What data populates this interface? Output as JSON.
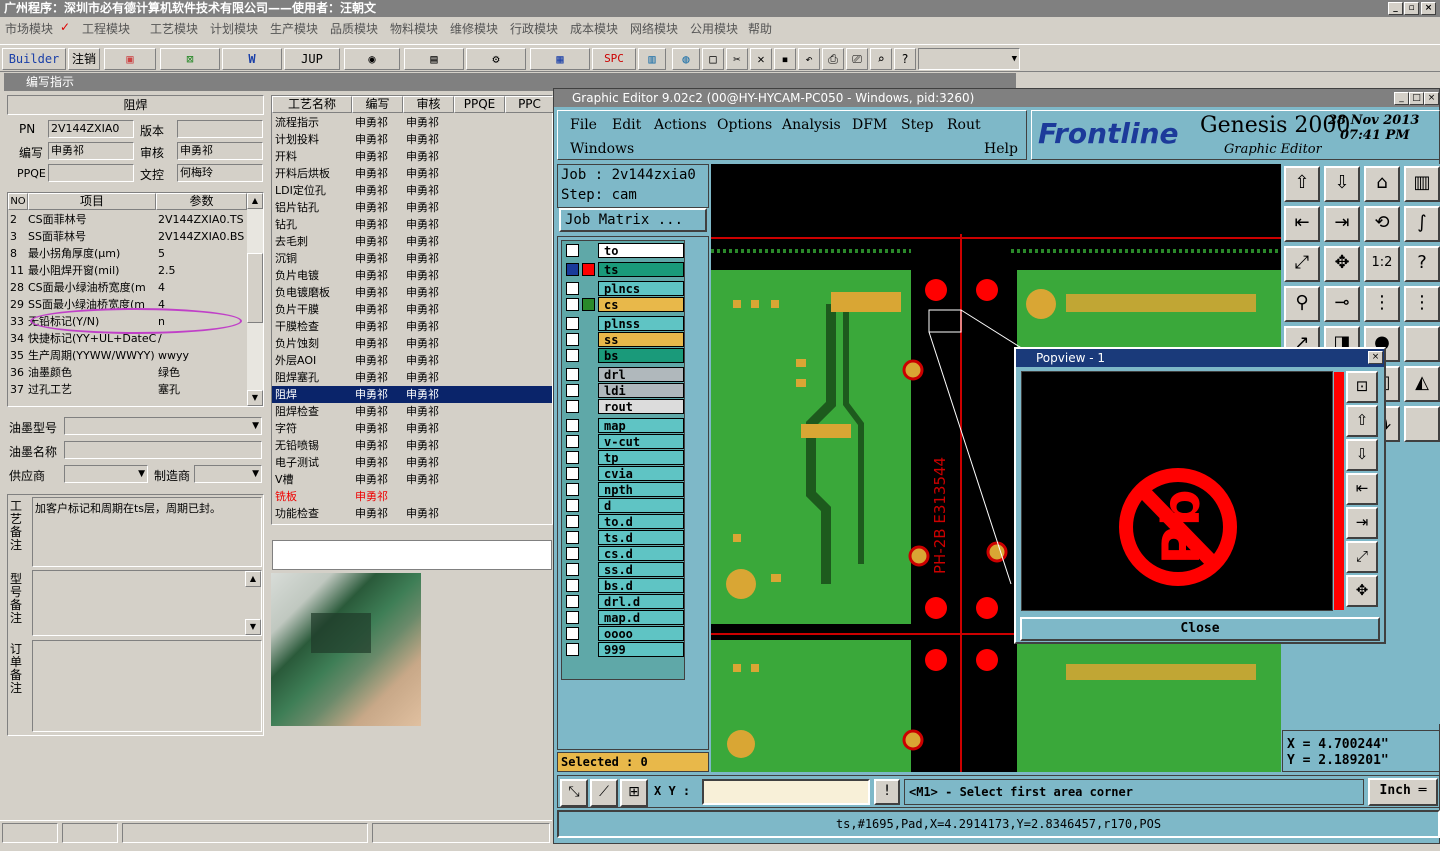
{
  "app": {
    "title": "广州程序：深圳市必有德计算机软件技术有限公司——使用者：汪朝文"
  },
  "menu": [
    "市场模块",
    "工程模块",
    "工艺模块",
    "计划模块",
    "生产模块",
    "品质模块",
    "物料模块",
    "维修模块",
    "行政模块",
    "成本模块",
    "网络模块",
    "公用模块",
    "帮助"
  ],
  "toolbar": {
    "builder": "Builder",
    "logout": "注销",
    "jup": "JUP",
    "spc": "SPC"
  },
  "left_window": {
    "title": "编写指示",
    "section": "阻焊",
    "fields": {
      "pn_label": "PN",
      "pn_value": "2V144ZXIA0",
      "version_label": "版本",
      "writer_label": "编写",
      "writer_value": "申勇祁",
      "review_label": "审核",
      "review_value": "申勇祁",
      "ppqe_label": "PPQE",
      "wenkong_label": "文控",
      "wenkong_value": "何梅玲"
    },
    "params_headers": [
      "NO",
      "项目",
      "参数"
    ],
    "params": [
      {
        "no": "2",
        "item": "CS面菲林号",
        "value": "2V144ZXIA0.TS"
      },
      {
        "no": "3",
        "item": "SS面菲林号",
        "value": "2V144ZXIA0.BS"
      },
      {
        "no": "8",
        "item": "最小拐角厚度(μm)",
        "value": "5"
      },
      {
        "no": "11",
        "item": "最小阻焊开窗(mil)",
        "value": "2.5"
      },
      {
        "no": "28",
        "item": "CS面最小绿油桥宽度(m",
        "value": "4"
      },
      {
        "no": "29",
        "item": "SS面最小绿油桥宽度(m",
        "value": "4"
      },
      {
        "no": "33",
        "item": "无铅标记(Y/N)",
        "value": "n"
      },
      {
        "no": "34",
        "item": "快捷标记(YY+UL+DateCo",
        "value": "/"
      },
      {
        "no": "35",
        "item": "生产周期(YYWW/WWYY)",
        "value": "wwyy"
      },
      {
        "no": "36",
        "item": "油墨颜色",
        "value": "绿色"
      },
      {
        "no": "37",
        "item": "过孔工艺",
        "value": "塞孔"
      }
    ],
    "ink_model_label": "油墨型号",
    "ink_name_label": "油墨名称",
    "supplier_label": "供应商",
    "maker_label": "制造商",
    "process_note_label": "工艺备注",
    "process_note": "加客户标记和周期在ts层，周期已封。",
    "model_note_label": "型号备注",
    "order_note_label": "订单备注"
  },
  "process_table": {
    "headers": [
      "工艺名称",
      "编写",
      "审核",
      "PPQE",
      "PPC"
    ],
    "rows": [
      [
        "流程指示",
        "申勇祁",
        "申勇祁"
      ],
      [
        "计划投料",
        "申勇祁",
        "申勇祁"
      ],
      [
        "开料",
        "申勇祁",
        "申勇祁"
      ],
      [
        "开料后烘板",
        "申勇祁",
        "申勇祁"
      ],
      [
        "LDI定位孔",
        "申勇祁",
        "申勇祁"
      ],
      [
        "铝片钻孔",
        "申勇祁",
        "申勇祁"
      ],
      [
        "钻孔",
        "申勇祁",
        "申勇祁"
      ],
      [
        "去毛刺",
        "申勇祁",
        "申勇祁"
      ],
      [
        "沉铜",
        "申勇祁",
        "申勇祁"
      ],
      [
        "负片电镀",
        "申勇祁",
        "申勇祁"
      ],
      [
        "负电镀磨板",
        "申勇祁",
        "申勇祁"
      ],
      [
        "负片干膜",
        "申勇祁",
        "申勇祁"
      ],
      [
        "干膜检查",
        "申勇祁",
        "申勇祁"
      ],
      [
        "负片蚀刻",
        "申勇祁",
        "申勇祁"
      ],
      [
        "外层AOI",
        "申勇祁",
        "申勇祁"
      ],
      [
        "阻焊塞孔",
        "申勇祁",
        "申勇祁"
      ],
      [
        "阻焊",
        "申勇祁",
        "申勇祁"
      ],
      [
        "阻焊检查",
        "申勇祁",
        "申勇祁"
      ],
      [
        "字符",
        "申勇祁",
        "申勇祁"
      ],
      [
        "无铅喷锡",
        "申勇祁",
        "申勇祁"
      ],
      [
        "电子测试",
        "申勇祁",
        "申勇祁"
      ],
      [
        "V槽",
        "申勇祁",
        "申勇祁"
      ],
      [
        "铣板",
        "申勇祁",
        ""
      ],
      [
        "功能检查",
        "申勇祁",
        "申勇祁"
      ]
    ]
  },
  "genesis": {
    "title": "Graphic Editor 9.02c2 (00@HY-HYCAM-PC050 - Windows, pid:3260)",
    "menus": [
      "File",
      "Edit",
      "Actions",
      "Options",
      "Analysis",
      "DFM",
      "Step",
      "Rout",
      "Windows",
      "Help"
    ],
    "brand": "Frontline",
    "product": "Genesis 2000",
    "subtitle": "Graphic Editor",
    "date": "28 Nov 2013",
    "time": "07:41 PM",
    "job": "Job : 2v144zxia0",
    "step": "Step: cam",
    "job_matrix": "Job Matrix ...",
    "layers": [
      {
        "name": "to",
        "color": "#ffffff"
      },
      {
        "name": "ts",
        "color": "#1a9a7a"
      },
      {
        "name": "plncs",
        "color": "#5fc4c4"
      },
      {
        "name": "cs",
        "color": "#e8b84a"
      },
      {
        "name": "plnss",
        "color": "#5fc4c4"
      },
      {
        "name": "ss",
        "color": "#e8b84a"
      },
      {
        "name": "bs",
        "color": "#1a9a7a"
      },
      {
        "name": "drl",
        "color": "#b0b8bc"
      },
      {
        "name": "ldi",
        "color": "#b0b8bc"
      },
      {
        "name": "rout",
        "color": "#dcdcdc"
      },
      {
        "name": "map",
        "color": "#5fc4c4"
      },
      {
        "name": "v-cut",
        "color": "#5fc4c4"
      },
      {
        "name": "tp",
        "color": "#5fc4c4"
      },
      {
        "name": "cvia",
        "color": "#5fc4c4"
      },
      {
        "name": "npth",
        "color": "#5fc4c4"
      },
      {
        "name": "d",
        "color": "#5fc4c4"
      },
      {
        "name": "to.d",
        "color": "#5fc4c4"
      },
      {
        "name": "ts.d",
        "color": "#5fc4c4"
      },
      {
        "name": "cs.d",
        "color": "#5fc4c4"
      },
      {
        "name": "ss.d",
        "color": "#5fc4c4"
      },
      {
        "name": "bs.d",
        "color": "#5fc4c4"
      },
      {
        "name": "drl.d",
        "color": "#5fc4c4"
      },
      {
        "name": "map.d",
        "color": "#5fc4c4"
      },
      {
        "name": "oooo",
        "color": "#5fc4c4"
      },
      {
        "name": "999",
        "color": "#5fc4c4"
      }
    ],
    "selected": "Selected : 0",
    "xy_label": "X Y :",
    "prompt": "<M1> - Select first area corner",
    "units": "Inch",
    "coord_x": "X = 4.700244\"",
    "coord_y": "Y = 2.189201\"",
    "status": "ts,#1695,Pad,X=4.2914173,Y=2.8346457,r170,POS",
    "popview_title": "Popview - 1",
    "popview_close": "Close",
    "board_text": "PH-2B E313544"
  }
}
